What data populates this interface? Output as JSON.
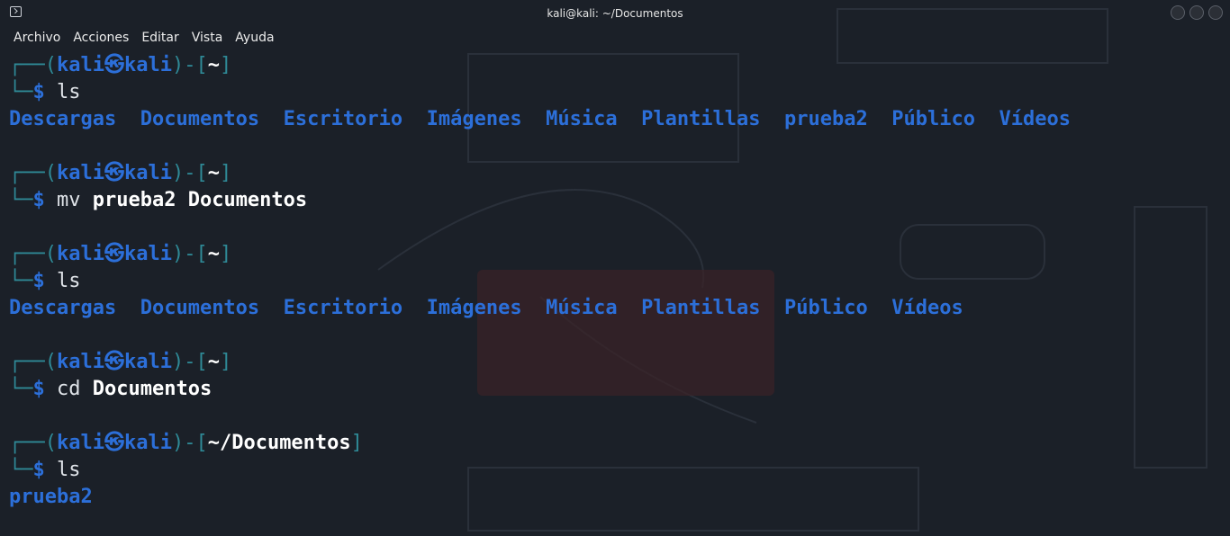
{
  "window": {
    "title": "kali@kali: ~/Documentos"
  },
  "menu": [
    "Archivo",
    "Acciones",
    "Editar",
    "Vista",
    "Ayuda"
  ],
  "prompt": {
    "top_corner": "┌──(",
    "user": "kali",
    "at_symbol": "㉿",
    "host": "kali",
    "mid": ")-[",
    "close": "]",
    "bottom_corner": "└─",
    "dollar": "$"
  },
  "blocks": [
    {
      "cwd": "~",
      "command": "ls",
      "args": "",
      "output": [
        "Descargas",
        "Documentos",
        "Escritorio",
        "Imágenes",
        "Música",
        "Plantillas",
        "prueba2",
        "Público",
        "Vídeos"
      ]
    },
    {
      "cwd": "~",
      "command": "mv",
      "args": "prueba2 Documentos",
      "output": []
    },
    {
      "cwd": "~",
      "command": "ls",
      "args": "",
      "output": [
        "Descargas",
        "Documentos",
        "Escritorio",
        "Imágenes",
        "Música",
        "Plantillas",
        "Público",
        "Vídeos"
      ]
    },
    {
      "cwd": "~",
      "command": "cd",
      "args": "Documentos",
      "output": []
    },
    {
      "cwd": "~/Documentos",
      "command": "ls",
      "args": "",
      "output": [
        "prueba2"
      ]
    }
  ],
  "colors": {
    "background": "#1b2028",
    "prompt_blue": "#2c6fd9",
    "frame_teal": "#2f8a97",
    "text_white": "#ffffff"
  }
}
